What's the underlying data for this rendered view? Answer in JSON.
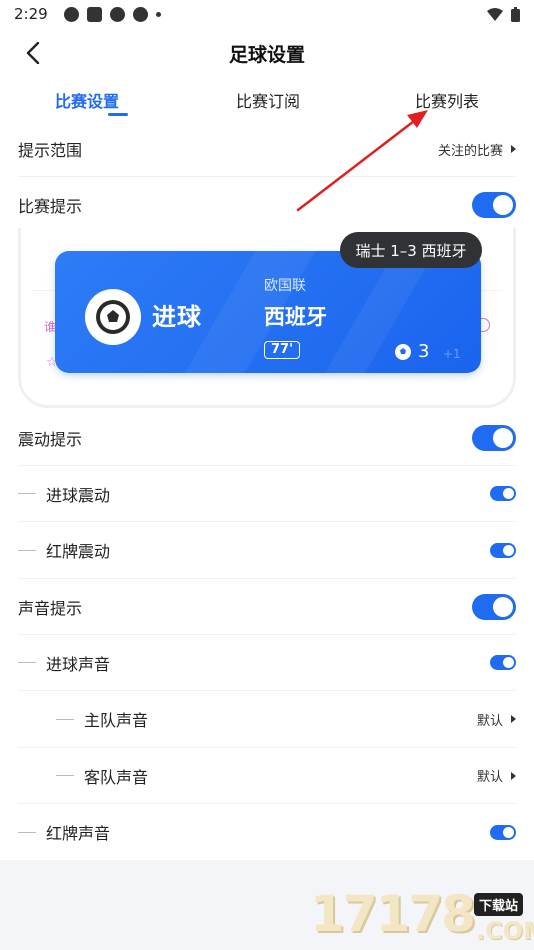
{
  "status_bar": {
    "time": "2:29"
  },
  "header": {
    "title": "足球设置"
  },
  "tabs": [
    {
      "label": "比赛设置",
      "active": true
    },
    {
      "label": "比赛订阅",
      "active": false
    },
    {
      "label": "比赛列表",
      "active": false
    }
  ],
  "settings": {
    "range": {
      "label": "提示范围",
      "value": "关注的比赛"
    },
    "match_alert": {
      "label": "比赛提示",
      "on": true
    },
    "vibration": {
      "label": "震动提示",
      "on": true
    },
    "goal_vibration": {
      "label": "进球震动",
      "on": true
    },
    "red_card_vibration": {
      "label": "红牌震动",
      "on": true
    },
    "sound": {
      "label": "声音提示",
      "on": true
    },
    "goal_sound": {
      "label": "进球声音",
      "on": true
    },
    "home_sound": {
      "label": "主队声音",
      "value": "默认"
    },
    "away_sound": {
      "label": "客队声音",
      "value": "默认"
    },
    "red_card_sound": {
      "label": "红牌声音",
      "on": true
    }
  },
  "preview": {
    "score_pill": "瑞士 1–3 西班牙",
    "goal_text": "进球",
    "league": "欧国联",
    "team": "西班牙",
    "minute": "77'",
    "goal_count": "3",
    "faded_count": "+1"
  },
  "watermark": {
    "number": "17178",
    "badge": "下载站",
    "suffix": ".COM"
  },
  "colors": {
    "accent": "#1f6cf2",
    "arrow": "#e02020"
  }
}
